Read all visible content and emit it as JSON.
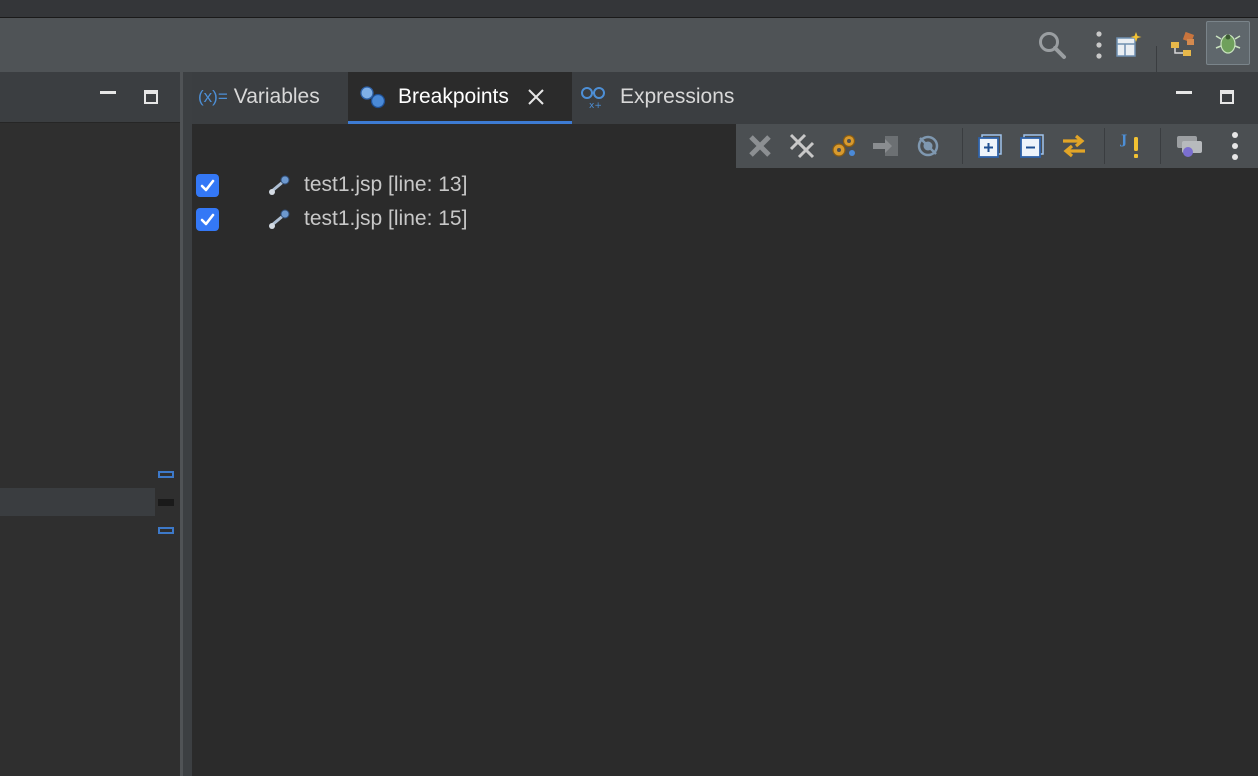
{
  "window": {
    "toolbar": {
      "icons": [
        "search-icon",
        "more-vertical-icon",
        "open-perspective-icon",
        "java-ee-perspective-icon",
        "debug-perspective-icon"
      ]
    }
  },
  "debug_view": {
    "tabs": [
      {
        "prefix": "(x)=",
        "label": "Variables",
        "icon": "variables-icon",
        "active": false
      },
      {
        "label": "Breakpoints",
        "icon": "breakpoints-icon",
        "active": true
      },
      {
        "label": "Expressions",
        "icon": "expressions-icon",
        "active": false
      }
    ],
    "breakpoints": [
      {
        "label": "test1.jsp [line: 13]",
        "enabled": true
      },
      {
        "label": "test1.jsp [line: 15]",
        "enabled": true
      }
    ],
    "toolbar_icons": [
      "remove-selected-icon",
      "remove-all-icon",
      "show-supported-icon",
      "go-to-file-icon",
      "skip-all-icon",
      "expand-all-icon",
      "collapse-all-icon",
      "link-with-debug-view-icon",
      "add-exception-breakpoint-icon",
      "import-export-icon",
      "view-menu-icon"
    ]
  },
  "colors": {
    "accent": "#3478f6",
    "tab_underline": "#3d7bd3"
  }
}
